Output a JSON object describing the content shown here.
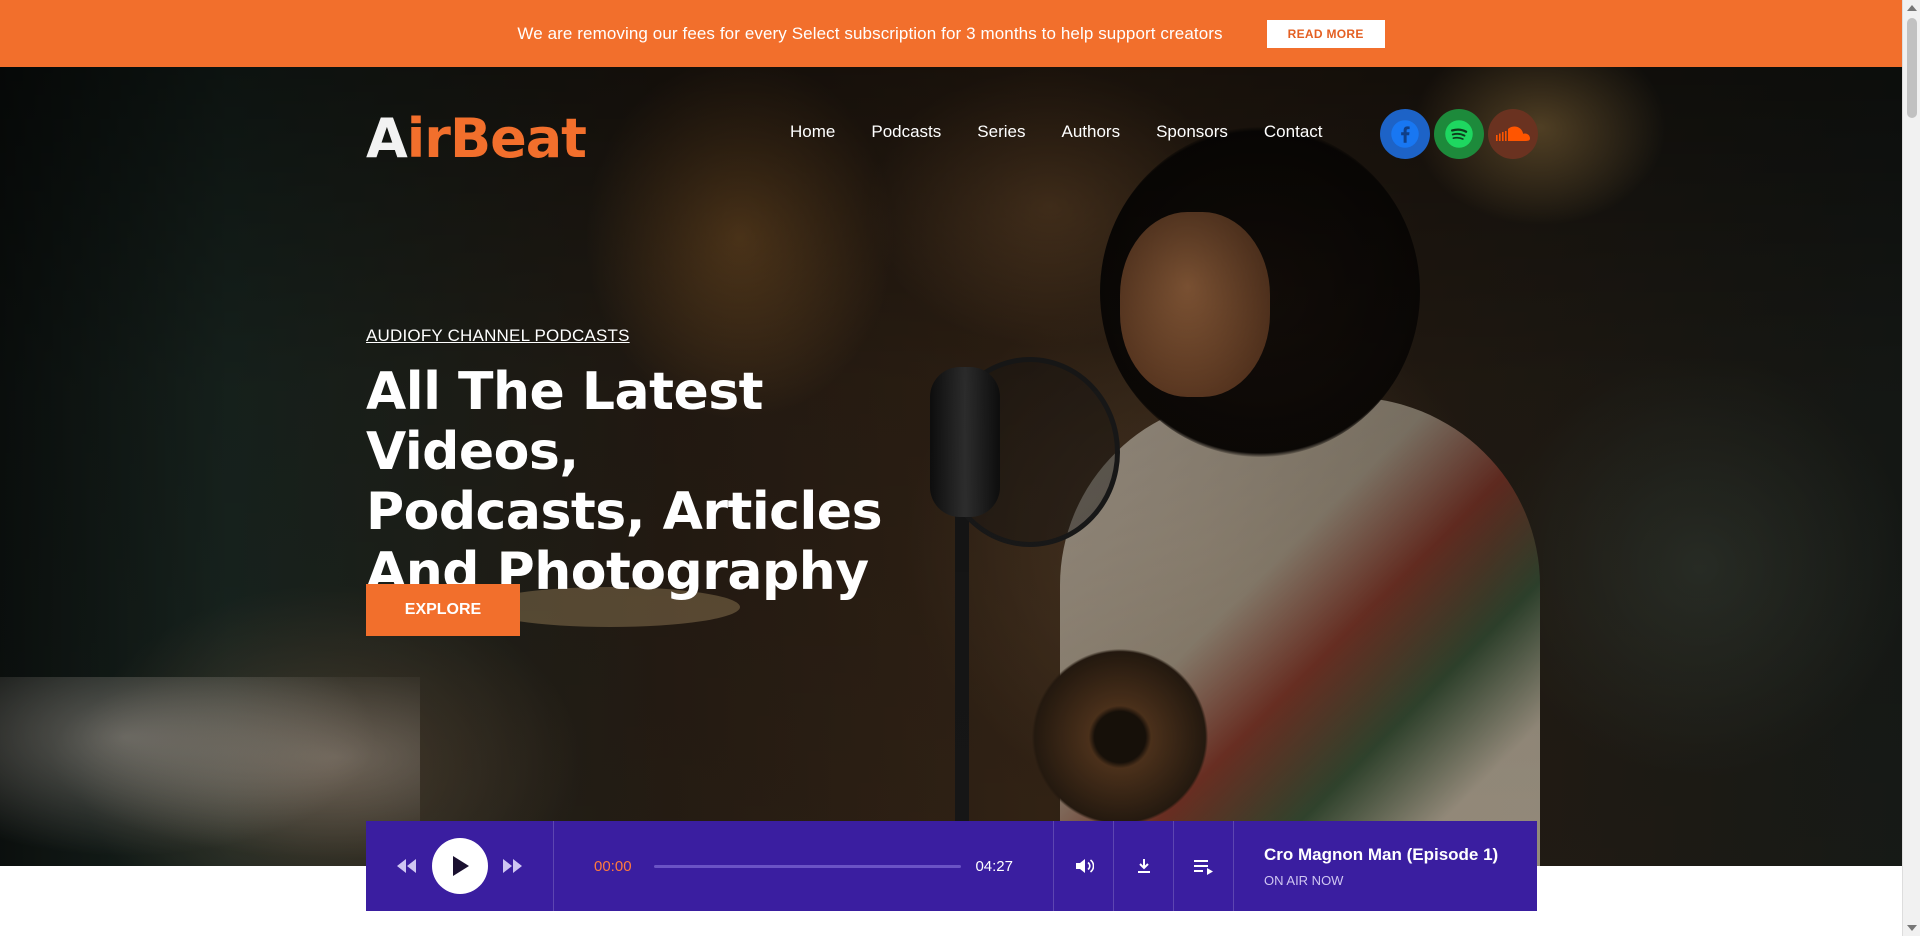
{
  "announcement": {
    "text": "We are removing our fees for every Select subscription for 3 months to help support creators",
    "button_label": "READ MORE"
  },
  "header": {
    "logo": {
      "part1": "A",
      "part2": "irBeat"
    },
    "nav": [
      "Home",
      "Podcasts",
      "Series",
      "Authors",
      "Sponsors",
      "Contact"
    ],
    "socials": [
      {
        "name": "facebook-icon",
        "color": "#1d63c7"
      },
      {
        "name": "spotify-icon",
        "color": "#1d8a3b"
      },
      {
        "name": "soundcloud-icon",
        "color": "#6a3220"
      }
    ]
  },
  "hero": {
    "eyebrow": "AUDIOFY CHANNEL PODCASTS",
    "headline": [
      "All The Latest Videos,",
      "Podcasts, Articles",
      "And Photography"
    ],
    "cta_label": "EXPLORE"
  },
  "player": {
    "current_time": "00:00",
    "total_time": "04:27",
    "progress": 0,
    "title": "Cro Magnon Man (Episode 1)",
    "subtitle": "ON AIR NOW"
  },
  "colors": {
    "accent": "#f26f2c",
    "player_bg": "#3a1ea0"
  }
}
